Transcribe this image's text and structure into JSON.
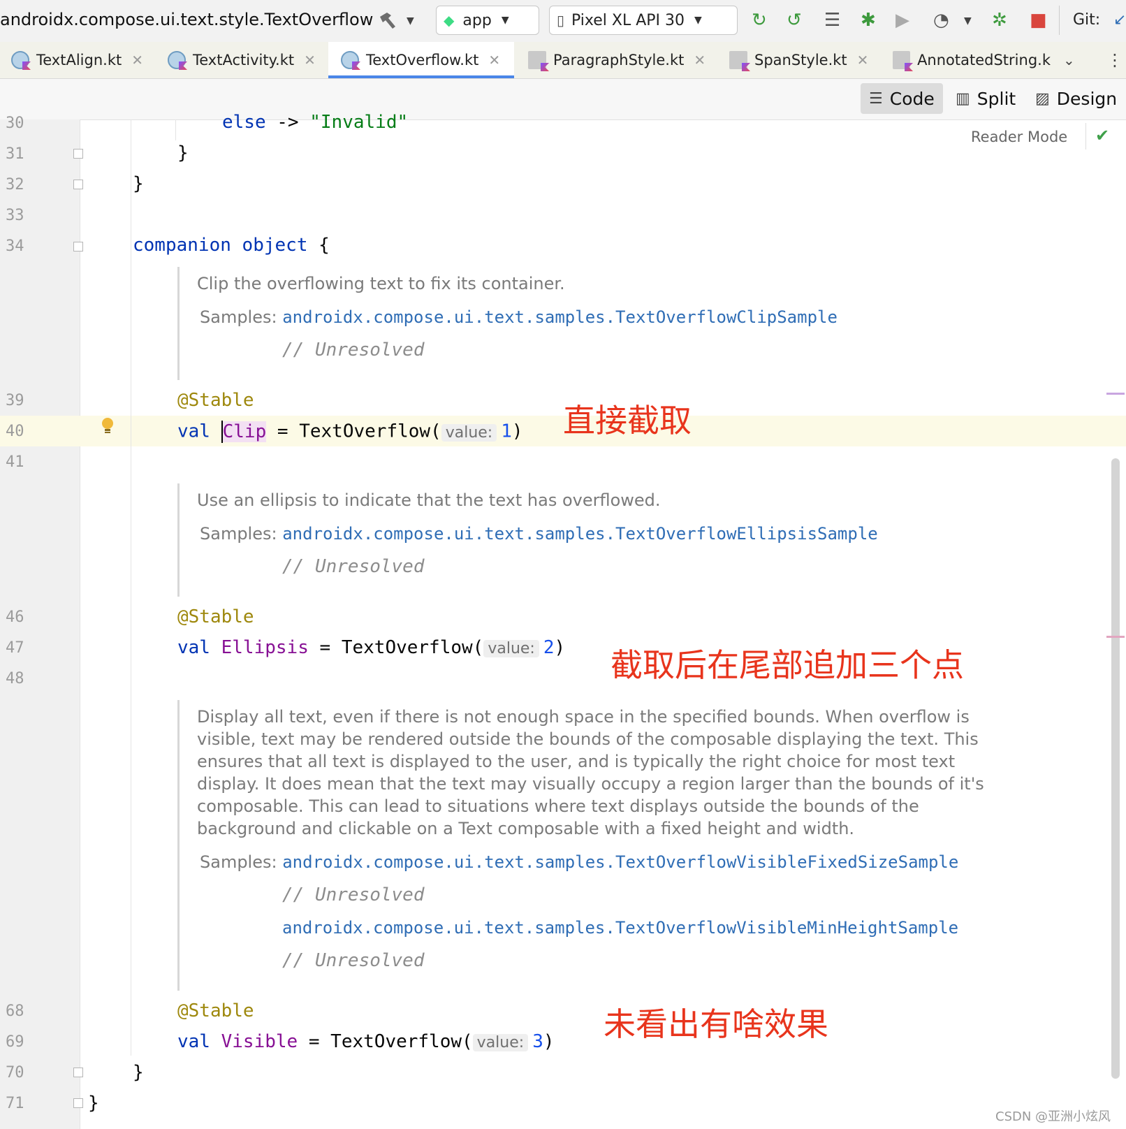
{
  "window": {
    "title": "androidx.compose.ui.text.style.TextOverflow"
  },
  "toolbar": {
    "config_combo": "app",
    "device_combo": "Pixel XL API 30",
    "git_label": "Git:",
    "icons": [
      "hammer-icon",
      "rerun-icon",
      "apply-changes-icon",
      "profile-icon",
      "debug-icon",
      "coverage-icon",
      "profiler-icon",
      "attach-debugger-icon",
      "stop-icon"
    ]
  },
  "tabs": [
    {
      "label": "TextAlign.kt",
      "type": "kotlin-file",
      "active": false
    },
    {
      "label": "TextActivity.kt",
      "type": "kotlin-file",
      "active": false
    },
    {
      "label": "TextOverflow.kt",
      "type": "kotlin-file",
      "active": true
    },
    {
      "label": "ParagraphStyle.kt",
      "type": "kotlin-class",
      "active": false
    },
    {
      "label": "SpanStyle.kt",
      "type": "kotlin-class",
      "active": false
    },
    {
      "label": "AnnotatedString.k",
      "type": "kotlin-class",
      "active": false
    }
  ],
  "view_modes": {
    "code": "Code",
    "split": "Split",
    "design": "Design",
    "active": "Code"
  },
  "reader_mode": "Reader Mode",
  "line_numbers": [
    "30",
    "31",
    "32",
    "33",
    "34",
    "39",
    "40",
    "41",
    "46",
    "47",
    "48",
    "68",
    "69",
    "70",
    "71"
  ],
  "code": {
    "l30_kw": "else",
    "l30_arrow": "->",
    "l30_str": "\"Invalid\"",
    "brace_close": "}",
    "companion": "companion",
    "object": "object",
    "brace_open": "{",
    "stable": "@Stable",
    "val": "val",
    "eq": "=",
    "ctor": "TextOverflow(",
    "hint_label": "value:",
    "rparen": ")",
    "clip_name": "Clip",
    "clip_value": "1",
    "ellipsis_name": "Ellipsis",
    "ellipsis_value": "2",
    "visible_name": "Visible",
    "visible_value": "3"
  },
  "docs": {
    "clip_text": "Clip the overflowing text to fix its container.",
    "ellipsis_text": "Use an ellipsis to indicate that the text has overflowed.",
    "visible_text": "Display all text, even if there is not enough space in the specified bounds. When overflow is visible, text may be rendered outside the bounds of the composable displaying the text. This ensures that all text is displayed to the user, and is typically the right choice for most text display. It does mean that the text may visually occupy a region larger than the bounds of it's composable. This can lead to situations where text displays outside the bounds of the background and clickable on a Text composable with a fixed height and width.",
    "samples_label": "Samples:",
    "clip_sample": "androidx.compose.ui.text.samples.TextOverflowClipSample",
    "ellipsis_sample": "androidx.compose.ui.text.samples.TextOverflowEllipsisSample",
    "visible_sample_1": "androidx.compose.ui.text.samples.TextOverflowVisibleFixedSizeSample",
    "visible_sample_2": "androidx.compose.ui.text.samples.TextOverflowVisibleMinHeightSample",
    "unresolved": "// Unresolved"
  },
  "annotations": {
    "clip_note": "直接截取",
    "ellipsis_note": "截取后在尾部追加三个点",
    "visible_note": "未看出有啥效果"
  },
  "watermark": "CSDN @亚洲小炫风",
  "colors": {
    "keyword": "#0033b3",
    "annotation": "#9e880d",
    "property": "#871094",
    "number": "#1750eb",
    "doc_link": "#2f6db5",
    "note_red": "#e8341c",
    "active_tab_underline": "#4a86e8"
  }
}
